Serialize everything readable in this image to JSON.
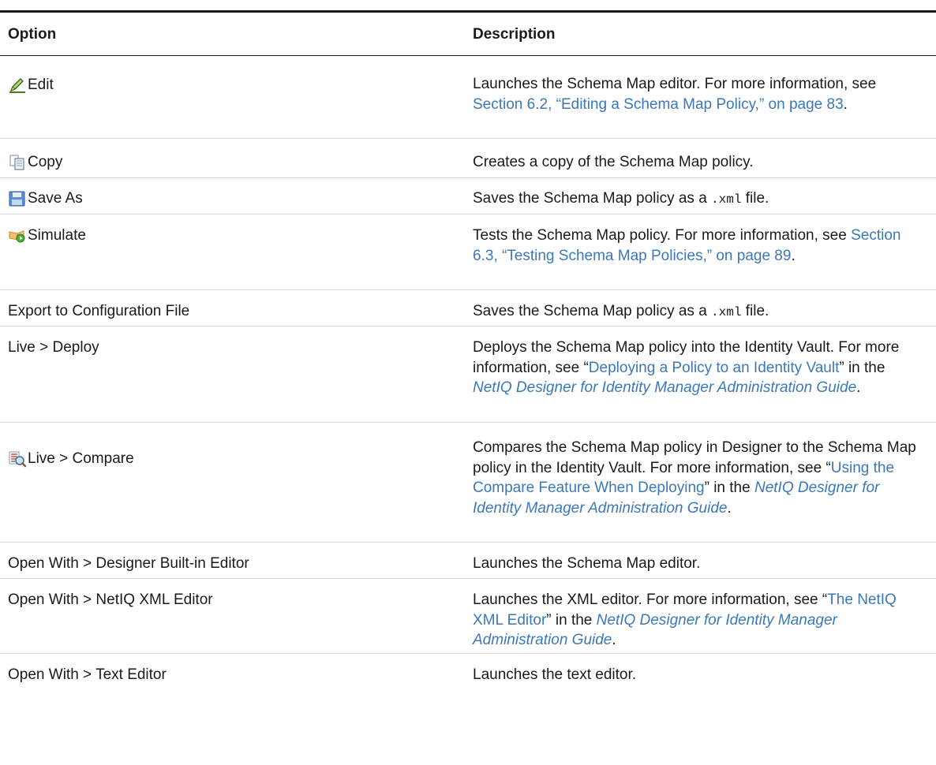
{
  "table": {
    "headers": {
      "option": "Option",
      "description": "Description"
    },
    "rows": [
      {
        "icon": "pencil-icon",
        "option": "Edit",
        "desc": [
          "Launches the Schema Map editor. For more information, see ",
          "Section 6.2, “Editing a Schema Map Policy,” on page 83",
          "."
        ]
      },
      {
        "icon": "copy-icon",
        "option": "Copy",
        "desc": [
          "Creates a copy of the Schema Map policy."
        ]
      },
      {
        "icon": "save-icon",
        "option": "Save As",
        "desc": [
          "Saves the Schema Map policy as a ",
          ".xml",
          " file."
        ]
      },
      {
        "icon": "simulate-icon",
        "option": "Simulate",
        "desc": [
          "Tests the Schema Map policy. For more information, see ",
          "Section 6.3, “Testing Schema Map Policies,” on page 89",
          "."
        ]
      },
      {
        "icon": "",
        "option": "Export to Configuration File",
        "desc": [
          "Saves the Schema Map policy as a ",
          ".xml",
          " file."
        ]
      },
      {
        "icon": "",
        "option": "Live > Deploy",
        "desc": [
          "Deploys the Schema Map policy into the Identity Vault. For more information, see “",
          "Deploying a Policy to an Identity Vault",
          "” in the ",
          "NetIQ Designer for Identity Manager Administration Guide",
          "."
        ]
      },
      {
        "icon": "compare-icon",
        "option": "Live > Compare",
        "desc": [
          "Compares the Schema Map policy in Designer to the Schema Map policy in the Identity Vault. For more information, see “",
          "Using the Compare Feature When Deploying",
          "” in the ",
          "NetIQ Designer for Identity Manager Administration Guide",
          "."
        ]
      },
      {
        "icon": "",
        "option": "Open With > Designer Built-in Editor",
        "desc": [
          "Launches the Schema Map editor."
        ]
      },
      {
        "icon": "",
        "option": "Open With > NetIQ XML Editor",
        "desc": [
          "Launches the XML editor. For more information, see “",
          "The NetIQ XML Editor",
          "” in the ",
          "NetIQ Designer for Identity Manager Administration Guide",
          "."
        ]
      },
      {
        "icon": "",
        "option": "Open With > Text Editor",
        "desc": [
          "Launches the text editor."
        ]
      }
    ]
  },
  "colors": {
    "link": "#3b78b8",
    "rule": "#1a1a1a",
    "separator": "#d6d6d6"
  }
}
